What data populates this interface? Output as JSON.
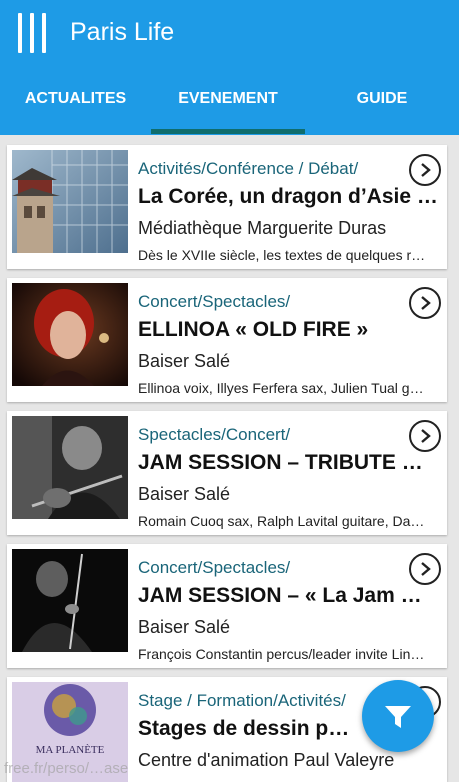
{
  "app": {
    "title": "Paris Life",
    "menu_icon": "menu-icon"
  },
  "tabs": [
    {
      "label": "ACTUALITES",
      "selected": false
    },
    {
      "label": "EVENEMENT",
      "selected": true
    },
    {
      "label": "GUIDE",
      "selected": false
    }
  ],
  "events": [
    {
      "category": "Activités/Conférence / Débat/",
      "title": "La Corée, un dragon d’Asie …",
      "venue": "Médiathèque Marguerite Duras",
      "description": "Dès le XVIIe siècle, les textes de quelques r…",
      "thumbnail": "pagoda-and-glass-building"
    },
    {
      "category": "Concert/Spectacles/",
      "title": "ELLINOA « OLD FIRE »",
      "venue": "Baiser Salé",
      "description": "Ellinoa voix, Illyes Ferfera sax, Julien Tual g…",
      "thumbnail": "singer-portrait"
    },
    {
      "category": "Spectacles/Concert/",
      "title": "JAM SESSION – TRIBUTE …",
      "venue": "Baiser Salé",
      "description": "Romain Cuoq sax, Ralph Lavital guitare, Da…",
      "thumbnail": "guitarist-black-and-white"
    },
    {
      "category": "Concert/Spectacles/",
      "title": "JAM SESSION – «  La Jam …",
      "venue": "Baiser Salé",
      "description": "François Constantin percus/leader invite Lin…",
      "thumbnail": "percussionist-black-and-white"
    },
    {
      "category": "Stage / Formation/Activités/",
      "title": "Stages de dessin pein…",
      "venue": "Centre d'animation Paul Valeyre",
      "description": "",
      "thumbnail": "ma-planete-poster",
      "thumb_caption": "MA PLANÈTE"
    }
  ],
  "fab": {
    "icon": "filter-icon"
  },
  "watermark": "free.fr/perso/…ase",
  "colors": {
    "primary": "#1e9be6",
    "tab_indicator": "#0f6d6d",
    "category_text": "#1a6579"
  }
}
